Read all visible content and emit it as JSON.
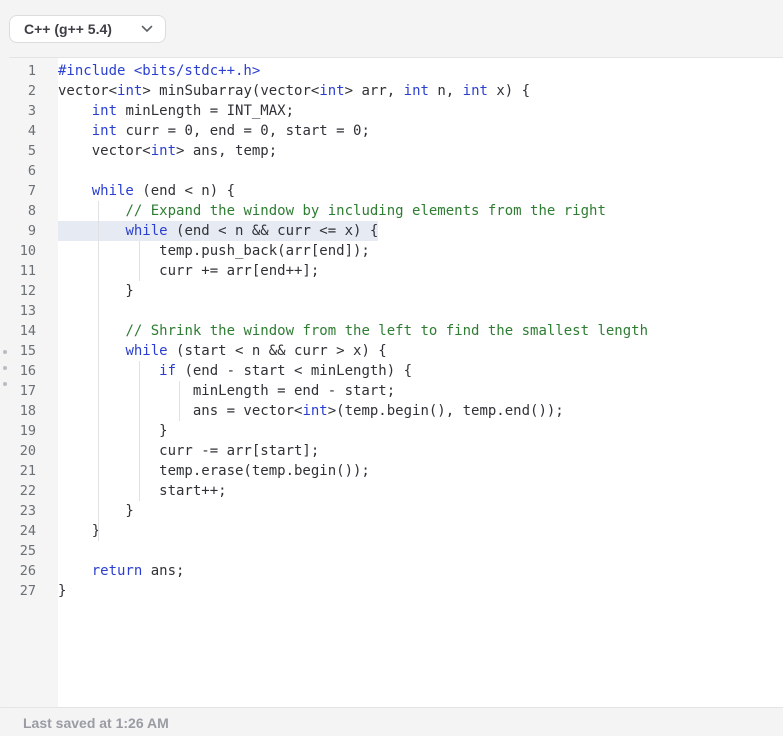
{
  "language_selector": {
    "label": "C++ (g++ 5.4)"
  },
  "editor": {
    "lines": [
      {
        "n": "1",
        "tokens": [
          [
            "pp",
            "#include <bits/stdc++.h>"
          ]
        ]
      },
      {
        "n": "2",
        "tokens": [
          [
            "t",
            "vector<"
          ],
          [
            "kw",
            "int"
          ],
          [
            "t",
            "> minSubarray(vector<"
          ],
          [
            "kw",
            "int"
          ],
          [
            "t",
            "> arr, "
          ],
          [
            "kw",
            "int"
          ],
          [
            "t",
            " n, "
          ],
          [
            "kw",
            "int"
          ],
          [
            "t",
            " x) {"
          ]
        ]
      },
      {
        "n": "3",
        "tokens": [
          [
            "t",
            "    "
          ],
          [
            "kw",
            "int"
          ],
          [
            "t",
            " minLength = INT_MAX;"
          ]
        ]
      },
      {
        "n": "4",
        "tokens": [
          [
            "t",
            "    "
          ],
          [
            "kw",
            "int"
          ],
          [
            "t",
            " curr = 0, end = 0, start = 0;"
          ]
        ]
      },
      {
        "n": "5",
        "tokens": [
          [
            "t",
            "    vector<"
          ],
          [
            "kw",
            "int"
          ],
          [
            "t",
            "> ans, temp;"
          ]
        ]
      },
      {
        "n": "6",
        "tokens": []
      },
      {
        "n": "7",
        "tokens": [
          [
            "t",
            "    "
          ],
          [
            "kw",
            "while"
          ],
          [
            "t",
            " (end < n) {"
          ]
        ]
      },
      {
        "n": "8",
        "tokens": [
          [
            "t",
            "        "
          ],
          [
            "cm",
            "// Expand the window by including elements from the right"
          ]
        ]
      },
      {
        "n": "9",
        "tokens": [
          [
            "t",
            "        "
          ],
          [
            "kw",
            "while"
          ],
          [
            "t",
            " (end < n && curr <= x) {"
          ]
        ],
        "active": true
      },
      {
        "n": "10",
        "tokens": [
          [
            "t",
            "            temp.push_back(arr[end]);"
          ]
        ]
      },
      {
        "n": "11",
        "tokens": [
          [
            "t",
            "            curr += arr[end++];"
          ]
        ]
      },
      {
        "n": "12",
        "tokens": [
          [
            "t",
            "        }"
          ]
        ]
      },
      {
        "n": "13",
        "tokens": []
      },
      {
        "n": "14",
        "tokens": [
          [
            "t",
            "        "
          ],
          [
            "cm",
            "// Shrink the window from the left to find the smallest length"
          ]
        ]
      },
      {
        "n": "15",
        "tokens": [
          [
            "t",
            "        "
          ],
          [
            "kw",
            "while"
          ],
          [
            "t",
            " (start < n && curr > x) {"
          ]
        ]
      },
      {
        "n": "16",
        "tokens": [
          [
            "t",
            "            "
          ],
          [
            "kw",
            "if"
          ],
          [
            "t",
            " (end - start < minLength) {"
          ]
        ]
      },
      {
        "n": "17",
        "tokens": [
          [
            "t",
            "                minLength = end - start;"
          ]
        ]
      },
      {
        "n": "18",
        "tokens": [
          [
            "t",
            "                ans = vector<"
          ],
          [
            "kw",
            "int"
          ],
          [
            "t",
            ">(temp.begin(), temp.end());"
          ]
        ]
      },
      {
        "n": "19",
        "tokens": [
          [
            "t",
            "            }"
          ]
        ]
      },
      {
        "n": "20",
        "tokens": [
          [
            "t",
            "            curr -= arr[start];"
          ]
        ]
      },
      {
        "n": "21",
        "tokens": [
          [
            "t",
            "            temp.erase(temp.begin());"
          ]
        ]
      },
      {
        "n": "22",
        "tokens": [
          [
            "t",
            "            start++;"
          ]
        ]
      },
      {
        "n": "23",
        "tokens": [
          [
            "t",
            "        }"
          ]
        ]
      },
      {
        "n": "24",
        "tokens": [
          [
            "t",
            "    }"
          ]
        ]
      },
      {
        "n": "25",
        "tokens": []
      },
      {
        "n": "26",
        "tokens": [
          [
            "t",
            "    "
          ],
          [
            "kw",
            "return"
          ],
          [
            "t",
            " ans;"
          ]
        ]
      },
      {
        "n": "27",
        "tokens": [
          [
            "t",
            "}"
          ]
        ]
      }
    ]
  },
  "status_bar": {
    "text": "Last saved at 1:26 AM"
  }
}
